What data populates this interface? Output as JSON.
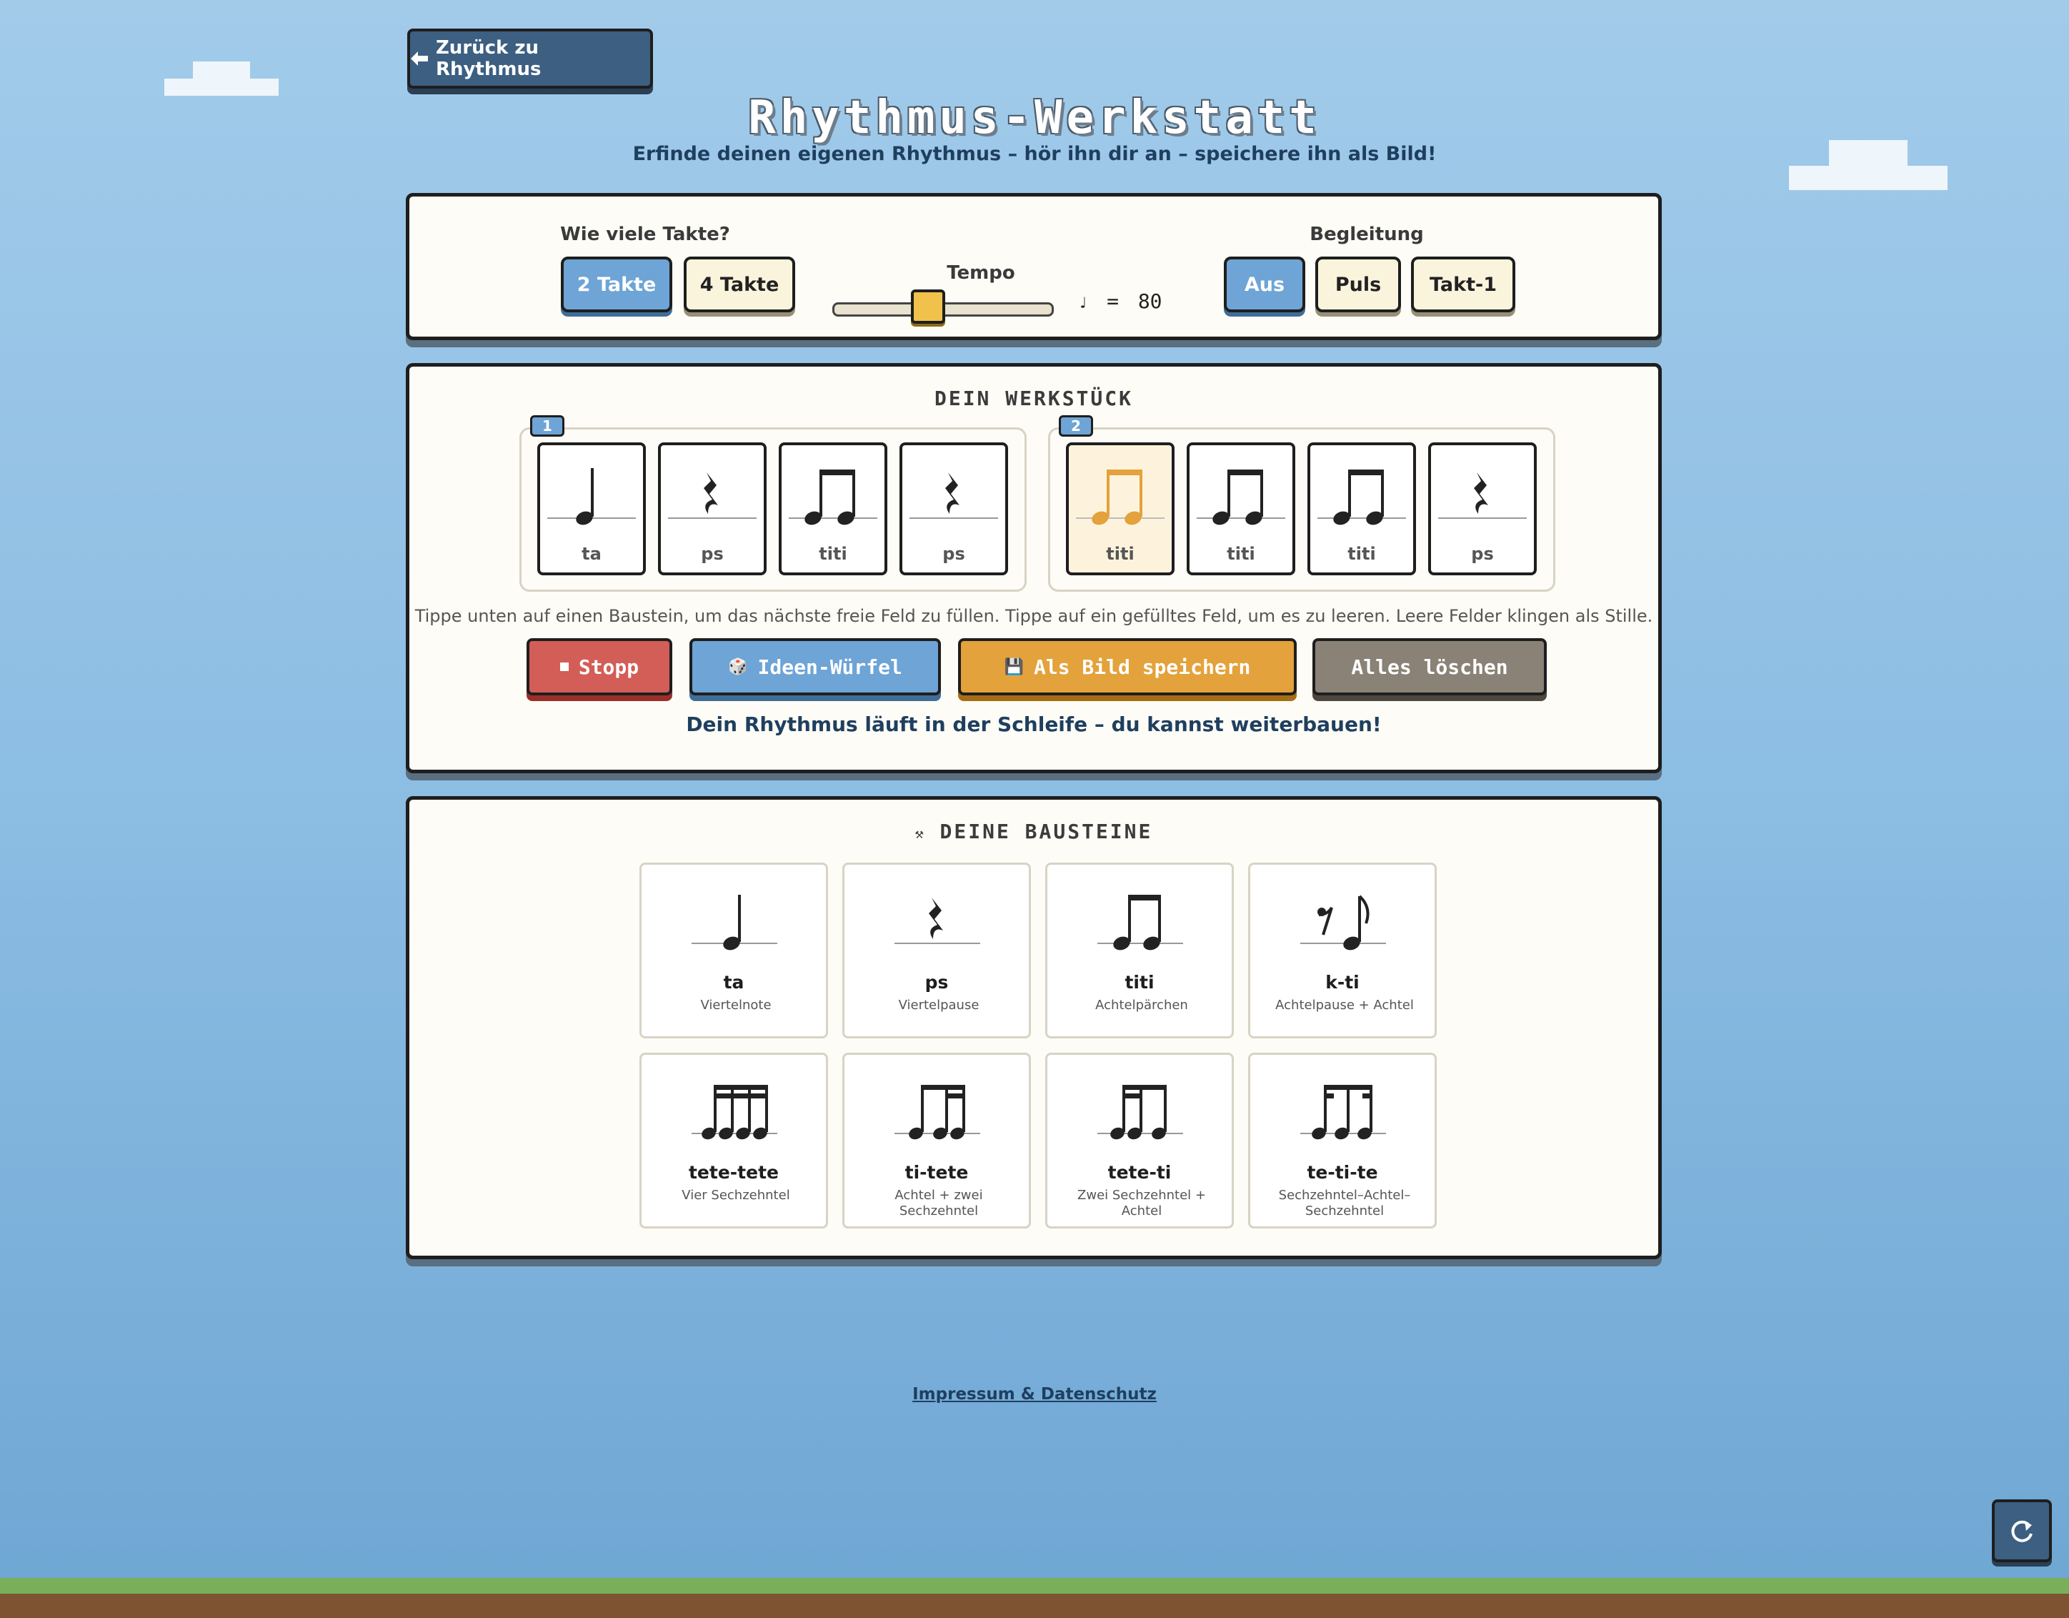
{
  "nav": {
    "back_label": "Zurück zu Rhythmus",
    "back_icon": "arrow-left-icon"
  },
  "header": {
    "title": "Rhythmus-Werkstatt",
    "subtitle": "Erfinde deinen eigenen Rhythmus – hör ihn dir an – speichere ihn als Bild!"
  },
  "settings": {
    "measures_label": "Wie viele Takte?",
    "measures_options": [
      "2 Takte",
      "4 Takte"
    ],
    "measures_selected": "2 Takte",
    "tempo_label": "Tempo",
    "tempo_note": "♩",
    "tempo_equals": "=",
    "tempo_value": "80",
    "tempo_slider_fraction": 0.4,
    "accompaniment_label": "Begleitung",
    "accompaniment_options": [
      "Aus",
      "Puls",
      "Takt-1"
    ],
    "accompaniment_selected": "Aus"
  },
  "workpiece": {
    "title": "DEIN WERKSTÜCK",
    "measures": [
      {
        "number": "1",
        "slots": [
          {
            "symbol": "ta",
            "label": "ta"
          },
          {
            "symbol": "ps",
            "label": "ps"
          },
          {
            "symbol": "titi",
            "label": "titi"
          },
          {
            "symbol": "ps",
            "label": "ps"
          }
        ]
      },
      {
        "number": "2",
        "slots": [
          {
            "symbol": "titi",
            "label": "titi",
            "playing": true
          },
          {
            "symbol": "titi",
            "label": "titi"
          },
          {
            "symbol": "titi",
            "label": "titi"
          },
          {
            "symbol": "ps",
            "label": "ps"
          }
        ]
      }
    ],
    "hint": "Tippe unten auf einen Baustein, um das nächste freie Feld zu füllen. Tippe auf ein gefülltes Feld, um es zu leeren. Leere Felder klingen als Stille.",
    "actions": {
      "stop": "Stopp",
      "dice": "Ideen-Würfel",
      "save": "Als Bild speichern",
      "clear": "Alles löschen"
    },
    "status": "Dein Rhythmus läuft in der Schleife – du kannst weiterbauen!"
  },
  "blocks": {
    "title": "DEINE BAUSTEINE",
    "title_icon": "tools-icon",
    "items": [
      {
        "symbol": "ta",
        "name": "ta",
        "desc": "Viertelnote"
      },
      {
        "symbol": "ps",
        "name": "ps",
        "desc": "Viertelpause"
      },
      {
        "symbol": "titi",
        "name": "titi",
        "desc": "Achtelpärchen"
      },
      {
        "symbol": "k-ti",
        "name": "k-ti",
        "desc": "Achtelpause + Achtel"
      },
      {
        "symbol": "tete-tete",
        "name": "tete-tete",
        "desc": "Vier Sechzehntel"
      },
      {
        "symbol": "ti-tete",
        "name": "ti-tete",
        "desc": "Achtel + zwei Sechzehntel"
      },
      {
        "symbol": "tete-ti",
        "name": "tete-ti",
        "desc": "Zwei Sechzehntel + Achtel"
      },
      {
        "symbol": "te-ti-te",
        "name": "te-ti-te",
        "desc": "Sechzehntel–Achtel–Sechzehntel"
      }
    ]
  },
  "footer": {
    "link": "Impressum & Datenschutz"
  },
  "colors": {
    "sky_top": "#a2cbea",
    "panel_bg": "#fdfcf6",
    "active_blue": "#6ea4d6",
    "stop_red": "#d35d57",
    "save_orange": "#e3a23b",
    "clear_gray": "#8a8276",
    "playing_orange": "#e3a23b"
  }
}
